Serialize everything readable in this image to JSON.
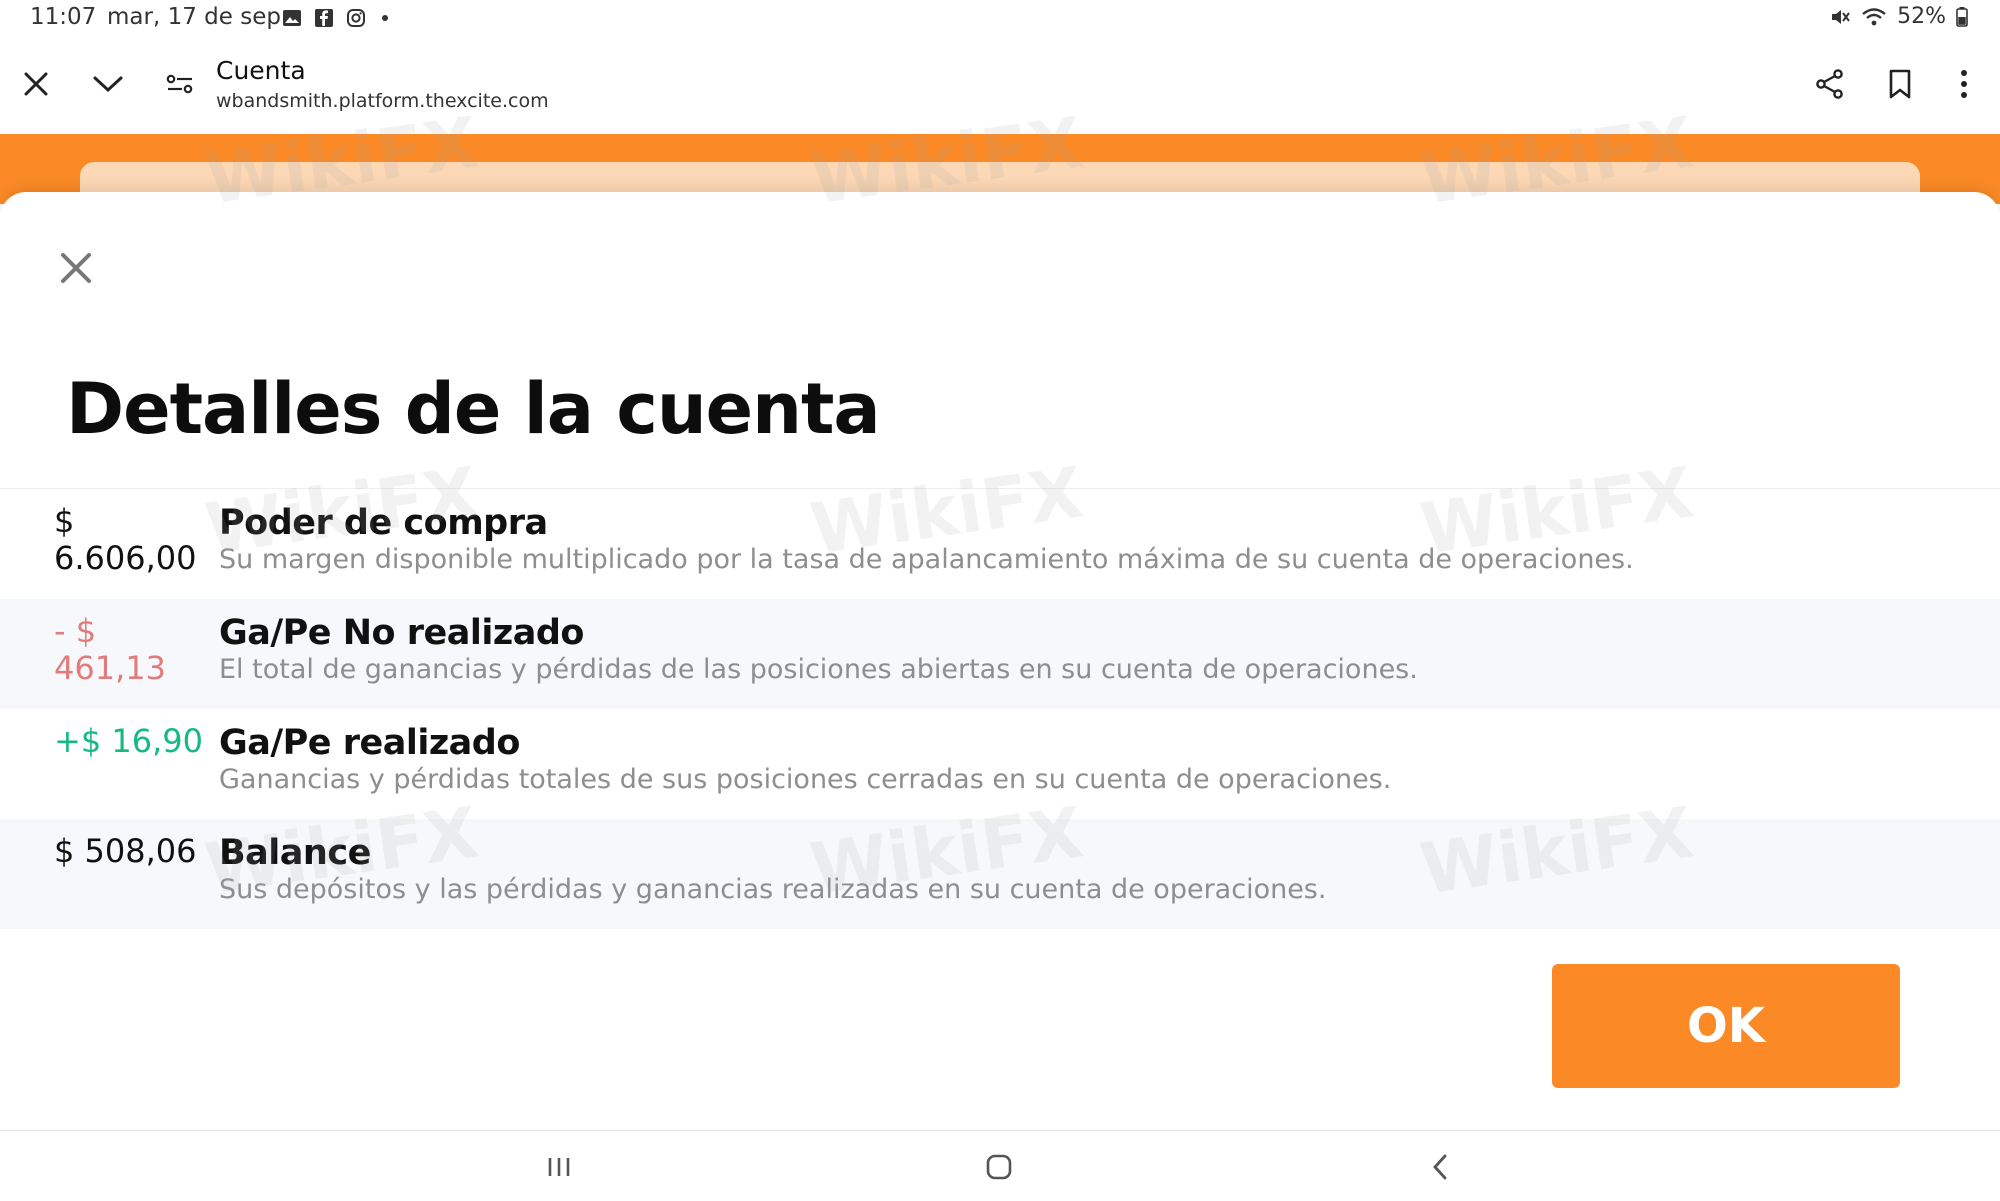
{
  "status_bar": {
    "time": "11:07",
    "date": "mar, 17 de sep.",
    "battery": "52%",
    "icons": [
      "gallery-icon",
      "facebook-icon",
      "instagram-icon",
      "mute-icon",
      "wifi-icon",
      "battery-icon"
    ]
  },
  "browser": {
    "page_title": "Cuenta",
    "url": "wbandsmith.platform.thexcite.com",
    "icons": [
      "close-icon",
      "chevron-down-icon",
      "page-settings-icon",
      "share-icon",
      "bookmark-icon",
      "more-icon"
    ]
  },
  "modal": {
    "title": "Detalles de la cuenta",
    "rows": [
      {
        "value": "$ 6.606,00",
        "label": "Poder de compra",
        "description": "Su margen disponible multiplicado por la tasa de apalancamiento máxima de su cuenta de operaciones."
      },
      {
        "value": "- $ 461,13",
        "label": "Ga/Pe No realizado",
        "description": "El total de ganancias y pérdidas de las posiciones abiertas en su cuenta de operaciones."
      },
      {
        "value": "+$ 16,90",
        "label": "Ga/Pe realizado",
        "description": "Ganancias y pérdidas totales de sus posiciones cerradas en su cuenta de operaciones."
      },
      {
        "value": "$ 508,06",
        "label": "Balance",
        "description": "Sus depósitos y las pérdidas y ganancias realizadas en su cuenta de operaciones."
      }
    ],
    "ok_label": "OK"
  },
  "colors": {
    "accent": "#fb8a26",
    "negative": "#e27b7b",
    "positive": "#16b884"
  },
  "watermark": "WikiFX"
}
